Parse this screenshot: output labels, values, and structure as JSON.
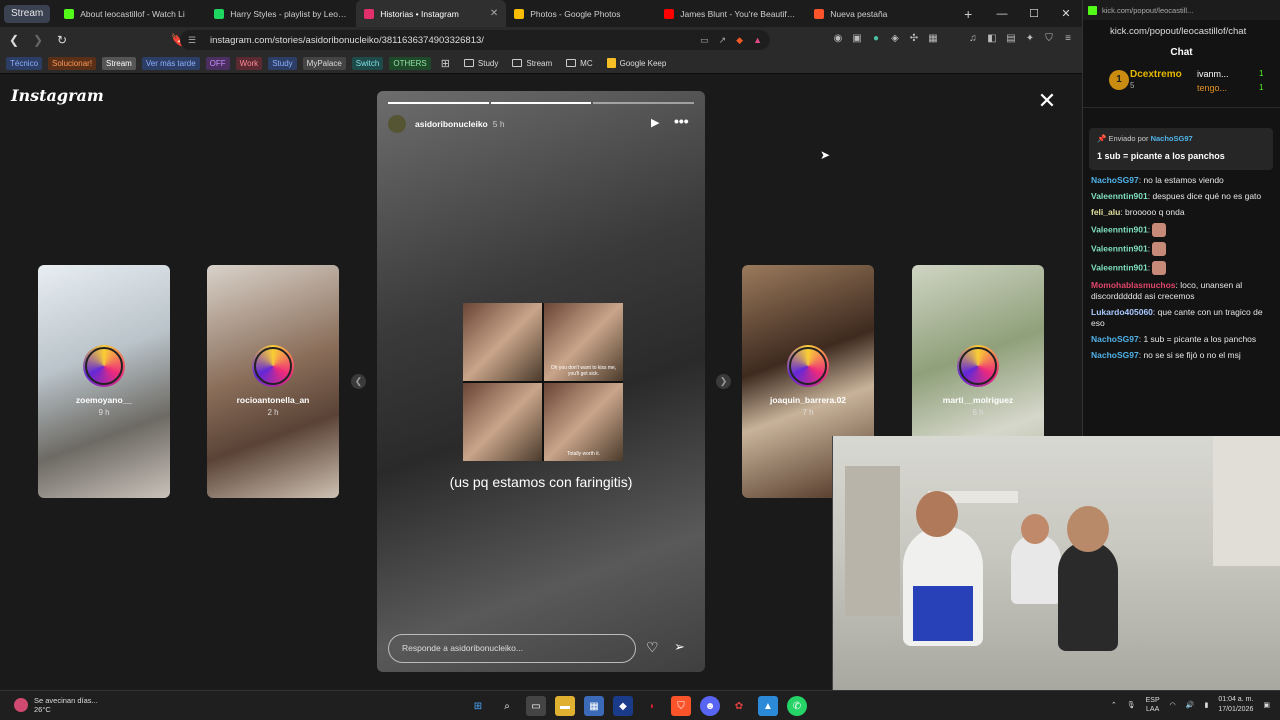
{
  "tabbar": {
    "group_label": "Stream",
    "tabs": [
      {
        "title": "About leocastillof - Watch Li",
        "color": "#53fc18"
      },
      {
        "title": "Harry Styles - playlist by Leo | Sp",
        "color": "#1ed760"
      },
      {
        "title": "Historias • Instagram",
        "color": "#e1306c",
        "active": true
      },
      {
        "title": "Photos - Google Photos",
        "color": "#fbbc04"
      },
      {
        "title": "James Blunt - You're Beautiful (O",
        "color": "#ff0000"
      },
      {
        "title": "Nueva pestaña",
        "color": "#fb542b"
      }
    ],
    "new_tab": "+"
  },
  "toolbar": {
    "url": "instagram.com/stories/asidoribonucleiko/3811636374903326813/"
  },
  "bookmarks": [
    {
      "label": "Técnico",
      "bg": "#2c3e66",
      "fg": "#8fb0ff"
    },
    {
      "label": "Solucionar!",
      "bg": "#5a2f18",
      "fg": "#ff9a5a"
    },
    {
      "label": "Stream",
      "bg": "#555555",
      "fg": "#ffffff"
    },
    {
      "label": "Ver más tarde",
      "bg": "#2c3e66",
      "fg": "#8fb0ff"
    },
    {
      "label": "OFF",
      "bg": "#4a2f60",
      "fg": "#c890ff"
    },
    {
      "label": "Work",
      "bg": "#5a2a30",
      "fg": "#ff8a9a"
    },
    {
      "label": "Study",
      "bg": "#2c3e66",
      "fg": "#8fb0ff"
    },
    {
      "label": "MyPalace",
      "bg": "#444444",
      "fg": "#dddddd"
    },
    {
      "label": "Switch",
      "bg": "#1f4a4a",
      "fg": "#7ee0e0"
    },
    {
      "label": "OTHERS",
      "bg": "#1f4a2a",
      "fg": "#8fe0a0"
    }
  ],
  "bookmark_folders": [
    "Study",
    "Stream",
    "MC",
    "Google Keep"
  ],
  "instagram": {
    "logo": "Instagram",
    "left_stories": [
      {
        "user": "zoemoyano__",
        "time": "9 h",
        "bg": "linear-gradient(160deg,#e8eef2,#b9c3c9 40%,#6d6a64 70%,#c9c2ba)"
      },
      {
        "user": "rocioantonella_an",
        "time": "2 h",
        "bg": "linear-gradient(160deg,#d9d2ca,#8a6e5a 45%,#5a4336 70%,#cfc2b4)"
      }
    ],
    "right_stories": [
      {
        "user": "joaquin_barrera.02",
        "time": "7 h",
        "bg": "linear-gradient(160deg,#9a7a5c,#3e2a1f 40%,#c8b39a 60%,#4a3020)"
      },
      {
        "user": "marti__molriguez",
        "time": "6 h",
        "bg": "linear-gradient(160deg,#cfd4c3,#8fa07a 40%,#d6d7cb 70%,#a7b098)"
      }
    ],
    "story": {
      "user": "asidoribonucleiko",
      "time": "5 h",
      "caption": "(us pq estamos con faringitis)",
      "collage_captions": [
        "",
        "Oh you don't want to kiss me, you'll get sick.",
        "",
        "Totally worth it."
      ],
      "reply_placeholder": "Responde a asidoribonucleiko...",
      "progress_segments": 3,
      "progress_done": 2
    }
  },
  "kick": {
    "window_title": "kick.com/popout/leocastill...",
    "url": "kick.com/popout/leocastillof/chat",
    "chat_title": "Chat",
    "top": {
      "badge": "1",
      "user1": "Dcextremo",
      "user1_count": "5",
      "user2": "ivanm...",
      "user2_count": "1",
      "user3": "tengo...",
      "user3_count": "1"
    },
    "pinned": {
      "by_label": "Enviado por",
      "by_user": "NachoSG97",
      "text": "1 sub = picante a los panchos"
    },
    "messages": [
      {
        "user": "NachoSG97",
        "color": "#4fb3e8",
        "text": "no la estamos viendo"
      },
      {
        "user": "Valeenntin901",
        "color": "#7fe0c0",
        "text": "despues dice qué no es gato"
      },
      {
        "user": "feli_alu",
        "color": "#e0e0a0",
        "text": "brooooo q onda"
      },
      {
        "user": "Valeenntin901",
        "color": "#7fe0c0",
        "text": ""
      },
      {
        "user": "Valeenntin901",
        "color": "#7fe0c0",
        "text": ""
      },
      {
        "user": "Valeenntin901",
        "color": "#7fe0c0",
        "text": ""
      },
      {
        "user": "Momohablasmuchos",
        "color": "#e0456a",
        "text": "loco, unansen al discordddddd asi crecemos"
      },
      {
        "user": "Lukardo405060",
        "color": "#a8c8ff",
        "text": "que cante con un tragico de eso"
      },
      {
        "user": "NachoSG97",
        "color": "#4fb3e8",
        "text": "1 sub = picante a los panchos"
      },
      {
        "user": "NachoSG97",
        "color": "#4fb3e8",
        "text": "no se si se fijó o no el msj"
      }
    ]
  },
  "taskbar": {
    "weather_text": "Se avecinan días...",
    "weather_temp": "26°C",
    "lang_top": "ESP",
    "lang_bottom": "LAA",
    "time": "01:04 a. m.",
    "date": "17/01/2026"
  }
}
